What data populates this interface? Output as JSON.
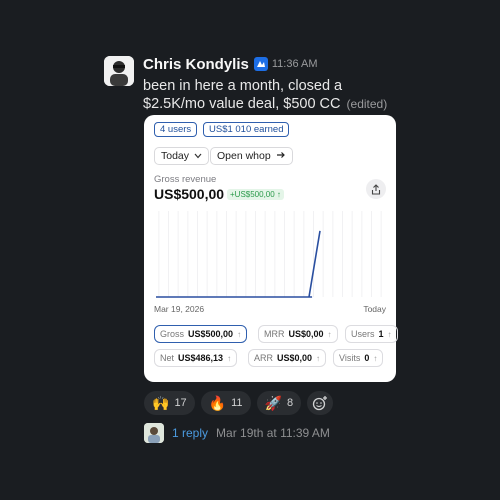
{
  "message": {
    "author": "Chris Kondylis",
    "time": "11:36 AM",
    "text": "been in here a month, closed a $2.5K/mo value deal, $500 CC",
    "edited": "(edited)"
  },
  "card": {
    "pills": [
      "4 users",
      "US$1 010 earned"
    ],
    "period_select": "Today",
    "open_button": "Open whop",
    "revenue_label": "Gross revenue",
    "revenue_value": "US$500,00",
    "revenue_delta": "+US$500,00 ↑",
    "chart_start_date": "Mar 19, 2026",
    "chart_end_date": "Today",
    "metrics": [
      {
        "label": "Gross",
        "value": "US$500,00",
        "arrow": "↑",
        "selected": true
      },
      {
        "label": "MRR",
        "value": "US$0,00",
        "arrow": "↑"
      },
      {
        "label": "Users",
        "value": "1",
        "arrow": "↑"
      },
      {
        "label": "Net",
        "value": "US$486,13",
        "arrow": "↑"
      },
      {
        "label": "ARR",
        "value": "US$0,00",
        "arrow": "↑"
      },
      {
        "label": "Visits",
        "value": "0",
        "arrow": "↑"
      }
    ]
  },
  "chart_data": {
    "type": "line",
    "x": [
      "Mar 19, 2026",
      "",
      "",
      "",
      "",
      "",
      "",
      "",
      "",
      "",
      "",
      "",
      "Today"
    ],
    "values": [
      0,
      0,
      0,
      0,
      0,
      0,
      0,
      0,
      0,
      0,
      0,
      0,
      500
    ],
    "ylim": [
      0,
      650
    ]
  },
  "reactions": [
    {
      "emoji": "🙌",
      "count": "17"
    },
    {
      "emoji": "🔥",
      "count": "11"
    },
    {
      "emoji": "🚀",
      "count": "8"
    }
  ],
  "thread": {
    "replies": "1 reply",
    "last_reply": "Mar 19th at 11:39 AM"
  },
  "colors": {
    "background": "#1a1d21",
    "link": "#4b9be0",
    "chart_line": "#2a4fa0",
    "selected_border": "#2f5fae"
  }
}
